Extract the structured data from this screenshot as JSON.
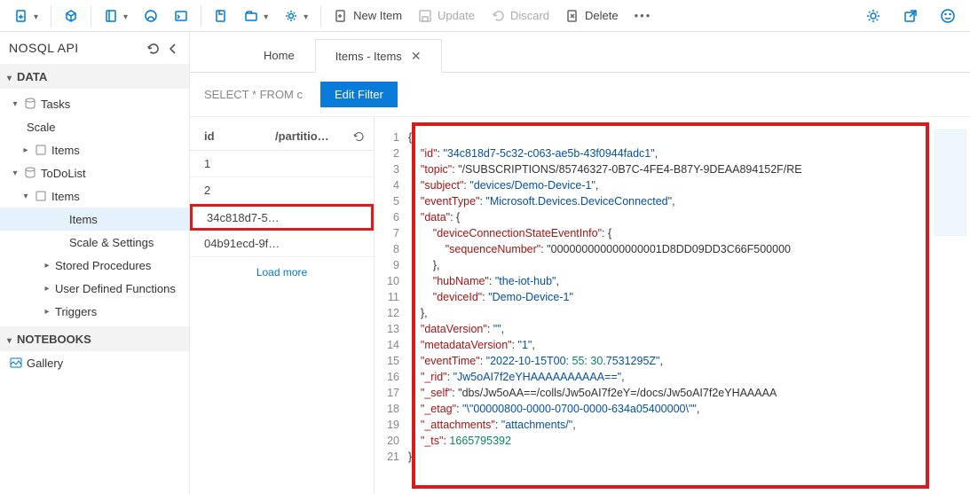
{
  "topbar": {
    "new_item": "New Item",
    "update": "Update",
    "discard": "Discard",
    "delete": "Delete"
  },
  "sidebar": {
    "title": "NOSQL API",
    "sections": {
      "data": "DATA",
      "notebooks": "NOTEBOOKS"
    },
    "tree": {
      "tasks": "Tasks",
      "scale": "Scale",
      "tasks_items": "Items",
      "todolist": "ToDoList",
      "tdl_items": "Items",
      "tdl_items_inner": "Items",
      "scale_settings": "Scale & Settings",
      "sprocs": "Stored Procedures",
      "udf": "User Defined Functions",
      "triggers": "Triggers",
      "gallery": "Gallery"
    }
  },
  "tabs": {
    "home": "Home",
    "items": "Items - Items"
  },
  "filter": {
    "query": "SELECT * FROM c",
    "button": "Edit Filter"
  },
  "itemlist": {
    "col_id": "id",
    "col_part": "/partitio…",
    "rows": [
      "1",
      "2",
      "34c818d7-5…",
      "04b91ecd-9f…"
    ],
    "loadmore": "Load more"
  },
  "json": {
    "lines": [
      "{",
      "    \"id\": \"34c818d7-5c32-c063-ae5b-43f0944fadc1\",",
      "    \"topic\": \"/SUBSCRIPTIONS/85746327-0B7C-4FE4-B87Y-9DEAA894152F/RE",
      "    \"subject\": \"devices/Demo-Device-1\",",
      "    \"eventType\": \"Microsoft.Devices.DeviceConnected\",",
      "    \"data\": {",
      "        \"deviceConnectionStateEventInfo\": {",
      "            \"sequenceNumber\": \"000000000000000001D8DD09DD3C66F500000",
      "        },",
      "        \"hubName\": \"the-iot-hub\",",
      "        \"deviceId\": \"Demo-Device-1\"",
      "    },",
      "    \"dataVersion\": \"\",",
      "    \"metadataVersion\": \"1\",",
      "    \"eventTime\": \"2022-10-15T00:55:30.7531295Z\",",
      "    \"_rid\": \"Jw5oAI7f2eYHAAAAAAAAAA==\",",
      "    \"_self\": \"dbs/Jw5oAA==/colls/Jw5oAI7f2eY=/docs/Jw5oAI7f2eYHAAAAA",
      "    \"_etag\": \"\\\"00000800-0000-0700-0000-634a05400000\\\"\",",
      "    \"_attachments\": \"attachments/\",",
      "    \"_ts\": 1665795392",
      "}"
    ]
  }
}
